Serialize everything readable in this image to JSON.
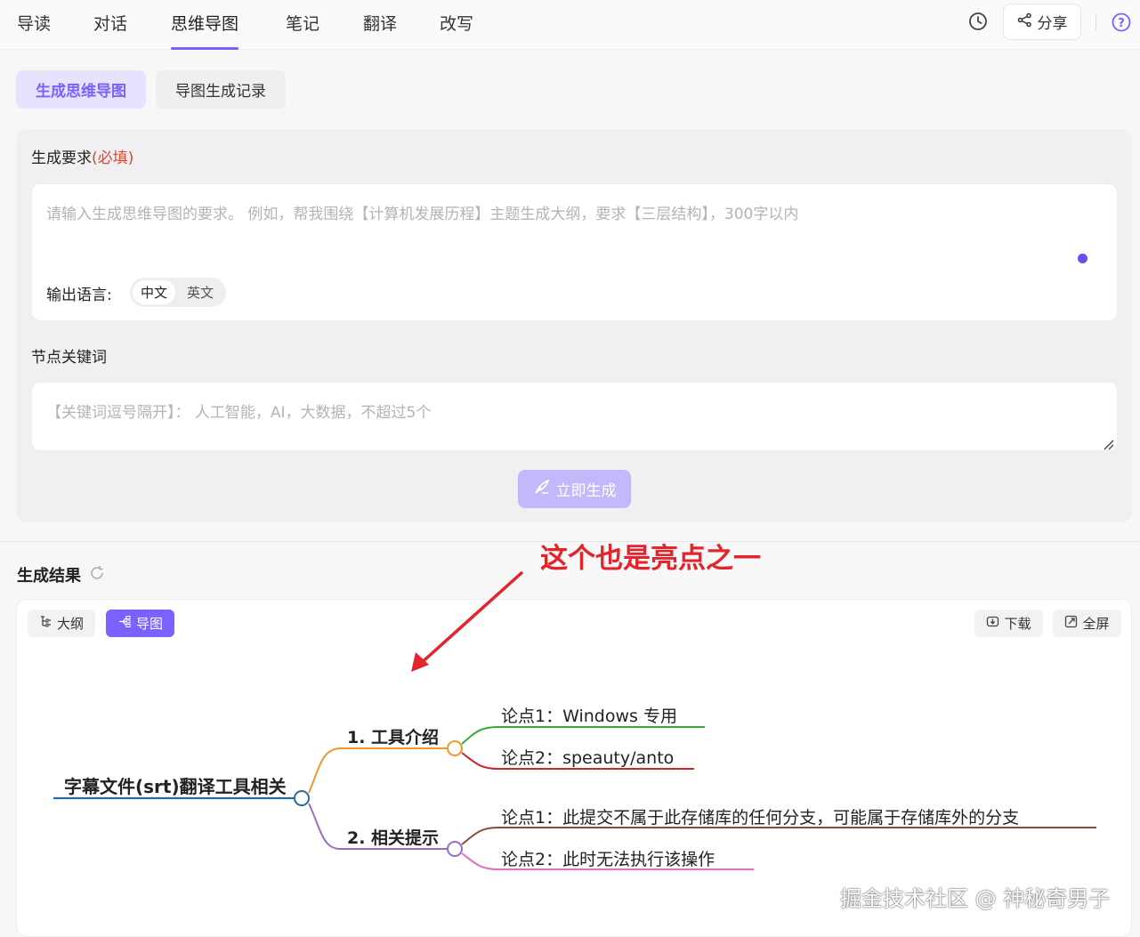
{
  "nav": {
    "tabs": [
      "导读",
      "对话",
      "思维导图",
      "笔记",
      "翻译",
      "改写"
    ],
    "active_tab": "思维导图",
    "share_label": "分享"
  },
  "subtabs": {
    "generate": "生成思维导图",
    "history": "导图生成记录"
  },
  "form": {
    "requirement_label": "生成要求",
    "requirement_required": "(必填)",
    "requirement_placeholder": "请输入生成思维导图的要求。 例如，帮我围绕【计算机发展历程】主题生成大纲，要求【三层结构】，300字以内",
    "language_label": "输出语言:",
    "language_options": [
      "中文",
      "英文"
    ],
    "language_selected": "中文",
    "keywords_label": "节点关键词",
    "keywords_placeholder": "【关键词逗号隔开】： 人工智能，AI，大数据，不超过5个",
    "generate_button": "立即生成"
  },
  "result": {
    "title": "生成结果",
    "view_outline": "大纲",
    "view_map": "导图",
    "download": "下载",
    "fullscreen": "全屏"
  },
  "mindmap": {
    "root": "字幕文件(srt)翻译工具相关",
    "branch1": "1. 工具介绍",
    "b1_leaf1": "论点1：Windows 专用",
    "b1_leaf2": "论点2：speauty/anto",
    "branch2": "2. 相关提示",
    "b2_leaf1": "论点1：此提交不属于此存储库的任何分支，可能属于存储库外的分支",
    "b2_leaf2": "论点2：此时无法执行该操作"
  },
  "annotation": "这个也是亮点之一",
  "watermark": "掘金技术社区 @ 神秘奇男子",
  "colors": {
    "accent": "#7b61ff",
    "root_line": "#2a6aa0",
    "branch1": "#f0962a",
    "branch2": "#9a6dc0",
    "annotation": "#e3242b"
  }
}
